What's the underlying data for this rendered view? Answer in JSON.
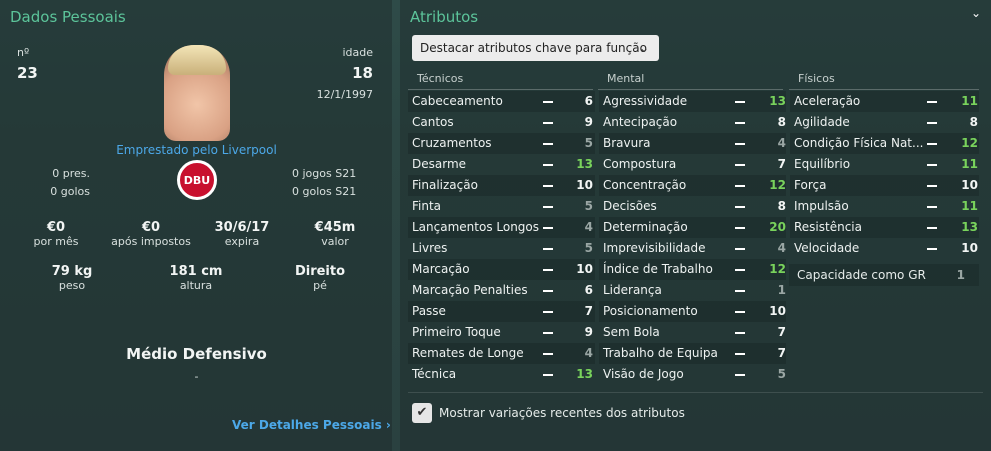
{
  "personal": {
    "title": "Dados Pessoais",
    "number_label": "nº",
    "number": "23",
    "age_label": "idade",
    "age": "18",
    "dob": "12/1/1997",
    "loan_text": "Emprestado pelo Liverpool",
    "club_crest_text": "DBU",
    "apps_left": "0 pres.",
    "goals_left": "0 golos",
    "apps_right": "0 jogos S21",
    "goals_right": "0 golos S21",
    "wage": "€0",
    "wage_label": "por mês",
    "after_tax": "€0",
    "after_tax_label": "após impostos",
    "expiry": "30/6/17",
    "expiry_label": "expira",
    "value": "€45m",
    "value_label": "valor",
    "weight": "79 kg",
    "weight_label": "peso",
    "height": "181 cm",
    "height_label": "altura",
    "foot": "Direito",
    "foot_label": "pé",
    "position": "Médio Defensivo",
    "position_sub": "-",
    "details_link": "Ver Detalhes Pessoais"
  },
  "attributes": {
    "title": "Atributos",
    "dropdown_label": "Destacar atributos chave para função",
    "technical_header": "Técnicos",
    "mental_header": "Mental",
    "physical_header": "Físicos",
    "technical": [
      {
        "name": "Cabeceamento",
        "value": "6",
        "tone": "white"
      },
      {
        "name": "Cantos",
        "value": "9",
        "tone": "white"
      },
      {
        "name": "Cruzamentos",
        "value": "5",
        "tone": "grey"
      },
      {
        "name": "Desarme",
        "value": "13",
        "tone": "green"
      },
      {
        "name": "Finalização",
        "value": "10",
        "tone": "white"
      },
      {
        "name": "Finta",
        "value": "5",
        "tone": "grey"
      },
      {
        "name": "Lançamentos Longos",
        "value": "4",
        "tone": "grey"
      },
      {
        "name": "Livres",
        "value": "5",
        "tone": "grey"
      },
      {
        "name": "Marcação",
        "value": "10",
        "tone": "white"
      },
      {
        "name": "Marcação Penalties",
        "value": "6",
        "tone": "white"
      },
      {
        "name": "Passe",
        "value": "7",
        "tone": "white"
      },
      {
        "name": "Primeiro Toque",
        "value": "9",
        "tone": "white"
      },
      {
        "name": "Remates de Longe",
        "value": "4",
        "tone": "grey"
      },
      {
        "name": "Técnica",
        "value": "13",
        "tone": "green"
      }
    ],
    "mental": [
      {
        "name": "Agressividade",
        "value": "13",
        "tone": "green"
      },
      {
        "name": "Antecipação",
        "value": "8",
        "tone": "white"
      },
      {
        "name": "Bravura",
        "value": "4",
        "tone": "grey"
      },
      {
        "name": "Compostura",
        "value": "7",
        "tone": "white"
      },
      {
        "name": "Concentração",
        "value": "12",
        "tone": "green"
      },
      {
        "name": "Decisões",
        "value": "8",
        "tone": "white"
      },
      {
        "name": "Determinação",
        "value": "20",
        "tone": "green"
      },
      {
        "name": "Imprevisibilidade",
        "value": "4",
        "tone": "grey"
      },
      {
        "name": "Índice de Trabalho",
        "value": "12",
        "tone": "green"
      },
      {
        "name": "Liderança",
        "value": "1",
        "tone": "grey"
      },
      {
        "name": "Posicionamento",
        "value": "10",
        "tone": "white"
      },
      {
        "name": "Sem Bola",
        "value": "7",
        "tone": "white"
      },
      {
        "name": "Trabalho de Equipa",
        "value": "7",
        "tone": "white"
      },
      {
        "name": "Visão de Jogo",
        "value": "5",
        "tone": "grey"
      }
    ],
    "physical": [
      {
        "name": "Aceleração",
        "value": "11",
        "tone": "green"
      },
      {
        "name": "Agilidade",
        "value": "8",
        "tone": "white"
      },
      {
        "name": "Condição Física Nat...",
        "value": "12",
        "tone": "green"
      },
      {
        "name": "Equilíbrio",
        "value": "11",
        "tone": "green"
      },
      {
        "name": "Força",
        "value": "10",
        "tone": "white"
      },
      {
        "name": "Impulsão",
        "value": "11",
        "tone": "green"
      },
      {
        "name": "Resistência",
        "value": "13",
        "tone": "green"
      },
      {
        "name": "Velocidade",
        "value": "10",
        "tone": "white"
      }
    ],
    "gk_label": "Capacidade como GR",
    "gk_value": "1",
    "checkbox_label": "Mostrar variações recentes dos atributos",
    "checkbox_checked": true
  },
  "colors": {
    "accent": "#5cc49a",
    "link": "#4ca8e8",
    "good": "#79d35c"
  }
}
